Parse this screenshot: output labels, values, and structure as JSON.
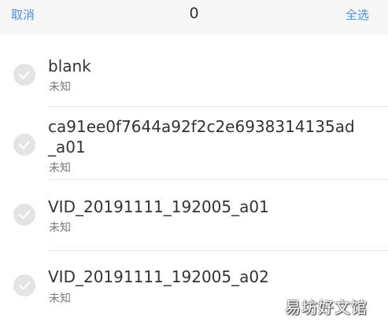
{
  "header": {
    "cancel_label": "取消",
    "selected_count": "0",
    "select_all_label": "全选"
  },
  "items": [
    {
      "title_line1": "blank",
      "title_line2": "",
      "subtitle": "未知"
    },
    {
      "title_line1": "ca91ee0f7644a92f2c2e6938314135ad",
      "title_line2": "_a01",
      "subtitle": "未知"
    },
    {
      "title_line1": "VID_20191111_192005_a01",
      "title_line2": "",
      "subtitle": "未知"
    },
    {
      "title_line1": "VID_20191111_192005_a02",
      "title_line2": "",
      "subtitle": "未知"
    }
  ],
  "watermark": "易坊好文馆",
  "colors": {
    "accent": "#4a90e2",
    "header_bg": "#f7f7f7",
    "check_bg": "#e4e4e4"
  }
}
